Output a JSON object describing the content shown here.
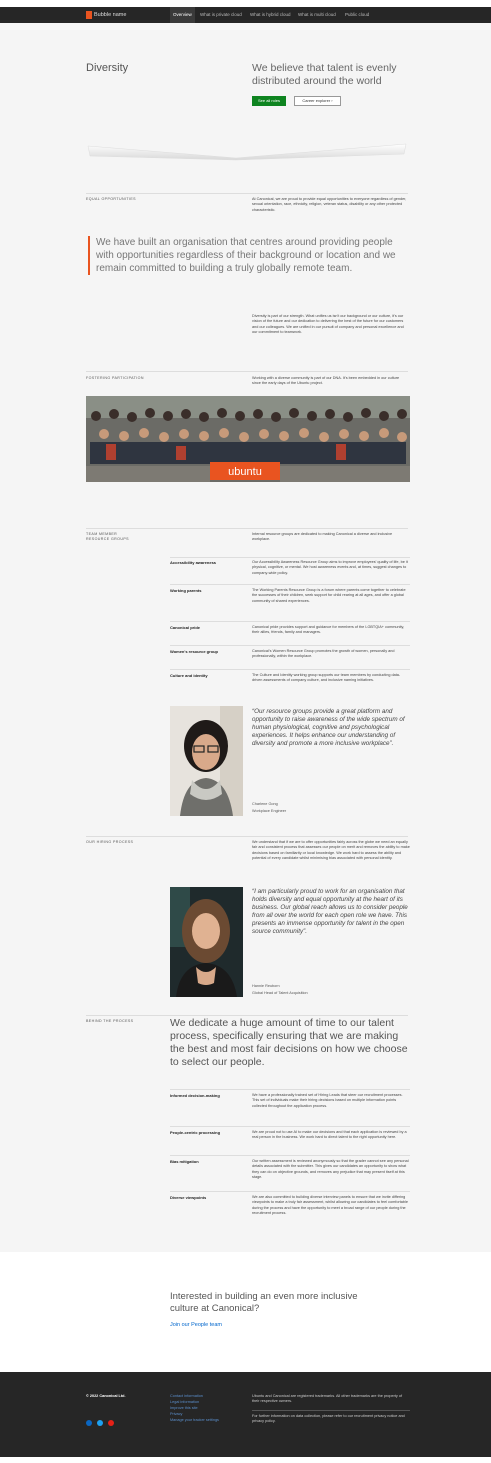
{
  "nav": {
    "brand": "Bubble name",
    "links": [
      "Overview",
      "What is private cloud",
      "What is hybrid cloud",
      "What is multi cloud",
      "Public cloud"
    ]
  },
  "hero": {
    "title": "Diversity",
    "heading": "We believe that talent is evenly distributed around the world",
    "btn_see": "See all roles",
    "btn_career": "Career explorer ›"
  },
  "equal": {
    "label": "EQUAL OPPORTUNITIES",
    "text": "At Canonical, we are proud to provide equal opportunities to everyone regardless of gender, sexual orientation, race, ethnicity, religion, veteran status, disability or any other protected characteristic."
  },
  "quote": "We have built an organisation that centres around providing people with opportunities regardless of their background or location and we remain committed to building a truly globally remote team.",
  "diversity_text": "Diversity is part of our strength. What unifies us isn't our background or our culture, it's our vision of the future and our dedication to delivering the best of the future for our customers and our colleagues. We are unified in our pursuit of company and personal excellence and our commitment to teamwork.",
  "fostering": {
    "label": "FOSTERING PARTICIPATION",
    "text": "Working with a diverse community is part of our DNA. It's been embedded in our culture since the early days of the Ubuntu project.",
    "banner": "ubuntu"
  },
  "groups": {
    "label": "TEAM MEMBER RESOURCE GROUPS",
    "intro": "Internal resource groups are dedicated to making Canonical a diverse and inclusive workplace.",
    "items": [
      {
        "name": "Accessibility awareness",
        "text": "Our Accessibility Awareness Resource Group aims to improve employees' quality of life, be it physical, cognitive, or mental. We host awareness events and, at times, suggest changes to company-wide policy."
      },
      {
        "name": "Working parents",
        "text": "The Working Parents Resource Group is a forum where parents come together to celebrate the successes of their children, seek support for child rearing at all ages, and offer a global community of shared experiences."
      },
      {
        "name": "Canonical pride",
        "text": "Canonical pride provides support and guidance for members of the LGBTQIA+ community, their allies, friends, family and managers."
      },
      {
        "name": "Women's resource group",
        "text": "Canonical's Women Resource Group promotes the growth of women, personally and professionally, within the workplace."
      },
      {
        "name": "Culture and identity",
        "text": "The Culture and Identity working group supports our team members by conducting data-driven assessments of company culture, and inclusive naming initiatives."
      }
    ],
    "quote": "“Our resource groups provide a great platform and opportunity to raise awareness of the wide spectrum of human physiological, cognitive and psychological experiences. It helps enhance our understanding of diversity and promote a more inclusive workplace”.",
    "person": "Charlene Gong",
    "role": "Workplace Engineer"
  },
  "hiring": {
    "label": "OUR HIRING PROCESS",
    "text": "We understand that if we are to offer opportunities fairly across the globe we need an equally fair and consistent process that assesses our people on merit and removes the ability to make decisions based on familiarity or local knowledge. We work hard to assess the ability and potential of every candidate whilst minimising bias associated with personal identity.",
    "quote": "“I am particularly proud to work for an organisation that holds diversity and equal opportunity at the heart of its business. Our global reach allows us to consider people from all over the world for each open role we have. This presents an immense opportunity for talent in the open source community”.",
    "person": "Hannie Reuborn",
    "role": "Global Head of Talent Acquisition"
  },
  "behind": {
    "label": "BEHIND THE PROCESS",
    "heading": "We dedicate a huge amount of time to our talent process, specifically ensuring that we are making the best and most fair decisions on how we choose to select our people.",
    "items": [
      {
        "name": "Informed decision-making",
        "text": "We have a professionally trained set of Hiring Leads that steer our recruitment processes. This set of individuals make their hiring decisions based on multiple information points collected throughout the application process."
      },
      {
        "name": "People-centric processing",
        "text": "We are proud not to use AI to make our decisions and that each application is reviewed by a real person in the business. We work hard to direct talent to the right opportunity here."
      },
      {
        "name": "Bias mitigation",
        "text": "Our written assessment is reviewed anonymously so that the grader cannot see any personal details associated with the submitter. This gives our candidates an opportunity to show what they can do on objective grounds, and removes any prejudice that may present itself at this stage."
      },
      {
        "name": "Diverse viewpoints",
        "text": "We are also committed to building diverse interview panels to ensure that we invite differing viewpoints to make a truly fair assessment, whilst allowing our candidates to feel comfortable during the process and have the opportunity to meet a broad range of our people during the recruitment process."
      }
    ]
  },
  "cta": {
    "heading": "Interested in building an even more inclusive culture at Canonical?",
    "link": "Join our People team"
  },
  "footer": {
    "copyright": "© 2022 Canonical Ltd.",
    "links": [
      "Contact information",
      "Legal information",
      "Improve this site",
      "Privacy",
      "Manage your tracker settings"
    ],
    "trademark": "Ubuntu and Canonical are registered trademarks. All other trademarks are the property of their respective owners.",
    "data_text": "For further information on data collection, please refer to our recruitment privacy notice and privacy policy.",
    "colors": {
      "linkedin": "#0a66c2",
      "twitter": "#1da1f2",
      "youtube": "#e62117"
    }
  }
}
